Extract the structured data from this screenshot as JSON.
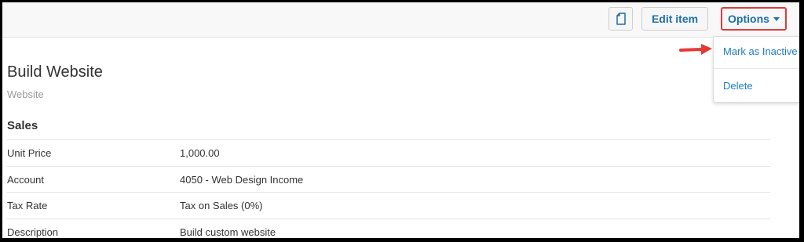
{
  "toolbar": {
    "copy_icon": "copy-icon",
    "edit_label": "Edit item",
    "options_label": "Options"
  },
  "dropdown": {
    "items": [
      {
        "label": "Mark as Inactive"
      },
      {
        "label": "Delete"
      }
    ]
  },
  "item": {
    "title": "Build Website",
    "subtitle": "Website"
  },
  "sales": {
    "heading": "Sales",
    "rows": [
      {
        "label": "Unit Price",
        "value": "1,000.00"
      },
      {
        "label": "Account",
        "value": "4050 - Web Design Income"
      },
      {
        "label": "Tax Rate",
        "value": "Tax on Sales (0%)"
      },
      {
        "label": "Description",
        "value": "Build custom website"
      }
    ]
  },
  "colors": {
    "link": "#1f7cc1",
    "highlight_border": "#e03a3a",
    "arrow": "#e53935"
  }
}
